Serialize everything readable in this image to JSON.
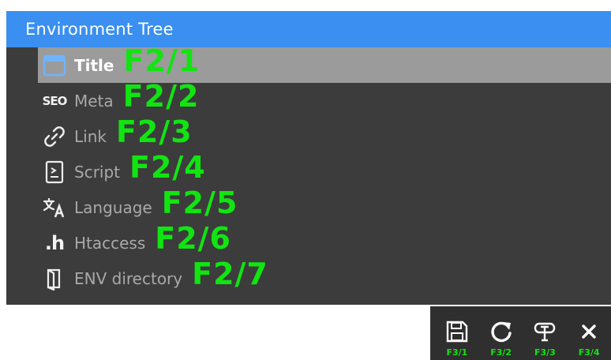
{
  "panel": {
    "title": "Environment Tree",
    "items": [
      {
        "label": "Title",
        "hint": "F2/1",
        "icon": "title-window-icon",
        "selected": true
      },
      {
        "label": "Meta",
        "hint": "F2/2",
        "icon": "seo-icon"
      },
      {
        "label": "Link",
        "hint": "F2/3",
        "icon": "link-icon"
      },
      {
        "label": "Script",
        "hint": "F2/4",
        "icon": "script-file-icon"
      },
      {
        "label": "Language",
        "hint": "F2/5",
        "icon": "translate-icon"
      },
      {
        "label": "Htaccess",
        "hint": "F2/6",
        "icon": "htaccess-icon"
      },
      {
        "label": "ENV directory",
        "hint": "F2/7",
        "icon": "folder-icon"
      }
    ]
  },
  "icon_text": {
    "seo": "SEO",
    "htaccess": ".h"
  },
  "toolbar": {
    "buttons": [
      {
        "icon": "save-icon",
        "hint": "F3/1"
      },
      {
        "icon": "refresh-icon",
        "hint": "F3/2"
      },
      {
        "icon": "text-format-icon",
        "hint": "F3/3"
      },
      {
        "icon": "close-icon",
        "hint": "F3/4"
      }
    ]
  },
  "colors": {
    "title_bar": "#3a8ff0",
    "panel_bg": "#3c3c3c",
    "selected_row": "#9b9b9b",
    "hint_green": "#11e511",
    "toolbar_bg": "#2f2f2f"
  }
}
